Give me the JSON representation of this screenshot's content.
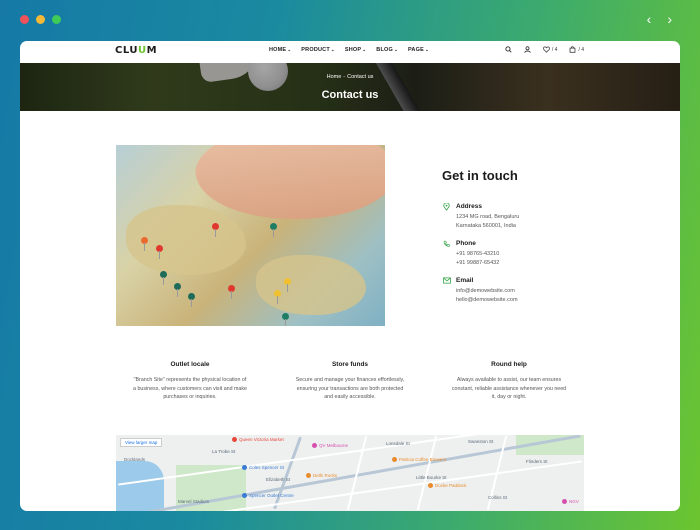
{
  "window": {
    "dots": [
      "#f0525a",
      "#f5b93a",
      "#3fcb58"
    ],
    "prev_icon": "‹",
    "next_icon": "›"
  },
  "header": {
    "logo_prefix": "CLU",
    "logo_accent": "U",
    "logo_suffix": "M",
    "nav": [
      {
        "label": "HOME"
      },
      {
        "label": "PRODUCT"
      },
      {
        "label": "SHOP"
      },
      {
        "label": "BLOG"
      },
      {
        "label": "PAGE"
      }
    ],
    "wishlist_count": "/ 4",
    "cart_count": "/ 4"
  },
  "banner": {
    "crumb_home": "Home",
    "crumb_sep": "-",
    "crumb_current": "Contact us",
    "title": "Contact us"
  },
  "contact": {
    "title": "Get in touch",
    "address_label": "Address",
    "address_line1": "1234 MG road, Bengaluru",
    "address_line2": "Karnataka 560001, India",
    "phone_label": "Phone",
    "phone_1": "+91 98765-43210",
    "phone_2": "+91 99887-65432",
    "email_label": "Email",
    "email_1": "info@demowebsite.com",
    "email_2": "hello@demowebsite.com"
  },
  "features": [
    {
      "title": "Outlet locale",
      "line1": "\"Branch Site\" represents the physical location of",
      "line2": "a business, where customers can visit and make",
      "line3": "purchases or inquiries."
    },
    {
      "title": "Store funds",
      "line1": "Secure and manage your finances effortlessly,",
      "line2": "ensuring your transactions are both protected",
      "line3": "and easily accessible."
    },
    {
      "title": "Round help",
      "line1": "Always available to assist, our team ensures",
      "line2": "constant, reliable assistance whenever you need",
      "line3": "it, day or night."
    }
  ],
  "map": {
    "larger_map": "View larger map",
    "labels": [
      "Lonsdale St",
      "Collins St",
      "La Trobe St",
      "Little Bourke St",
      "Flinders St",
      "Marvel Stadium",
      "Docklands",
      "Swanston St",
      "Elizabeth St"
    ],
    "pois": [
      {
        "label": "Queen Victoria Market",
        "color": "#e8473d"
      },
      {
        "label": "QV Melbourne",
        "color": "#d64fb0"
      },
      {
        "label": "Patricia Coffee Brewers",
        "color": "#e98a2c"
      },
      {
        "label": "Coles Spencer St",
        "color": "#3a7bd5"
      },
      {
        "label": "Delhi Rocks",
        "color": "#e98a2c"
      },
      {
        "label": "Docke Paddock",
        "color": "#e98a2c"
      },
      {
        "label": "Spencer Outlet Centre",
        "color": "#3a7bd5"
      },
      {
        "label": "NGV",
        "color": "#d64fb0"
      }
    ]
  }
}
